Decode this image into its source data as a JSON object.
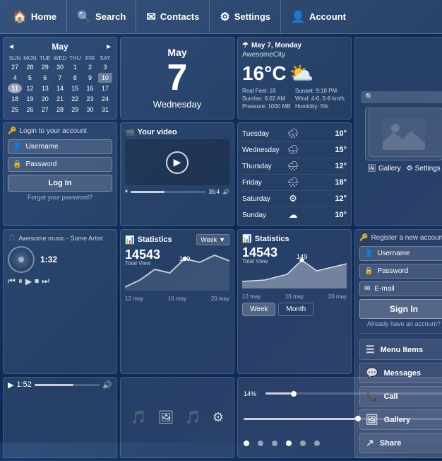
{
  "nav": {
    "items": [
      {
        "label": "Home",
        "icon": "🏠"
      },
      {
        "label": "Search",
        "icon": "🔍"
      },
      {
        "label": "Contacts",
        "icon": "✉"
      },
      {
        "label": "Settings",
        "icon": "⚙"
      },
      {
        "label": "Account",
        "icon": "👤"
      }
    ]
  },
  "calendar": {
    "month": "May",
    "prev_arrow": "◄",
    "next_arrow": "►",
    "day_names": [
      "SUN",
      "MON",
      "TUE",
      "WED",
      "THU",
      "FRI",
      "SAT"
    ],
    "days": [
      "27",
      "28",
      "29",
      "30",
      "1",
      "2",
      "3",
      "4",
      "5",
      "6",
      "7",
      "8",
      "9",
      "10",
      "11",
      "12",
      "13",
      "14",
      "15",
      "16",
      "17",
      "18",
      "19",
      "20",
      "21",
      "22",
      "23",
      "24",
      "25",
      "26",
      "27",
      "28",
      "29",
      "30",
      "31"
    ],
    "today_idx": 13,
    "highlight_idx": 14
  },
  "bigdate": {
    "month": "May",
    "day": "7",
    "weekday": "Wednesday"
  },
  "weather": {
    "title": "May 7, Monday",
    "city": "AwesomeCity",
    "temp": "16°C",
    "feel": "Real Feel: 18",
    "sunrise": "Sunrise: 6:02 AM",
    "wind": "Wind: 4-6, 5-9 km/h",
    "pressure": "Pressure: 1000 MB",
    "humidity": "Humidity: 5%",
    "sunset": "Sunset: 9:18 PM"
  },
  "photo": {
    "search_placeholder": "🔍",
    "gallery_label": "Gallery",
    "settings_label": "Settings"
  },
  "login": {
    "title": "Login to your account",
    "username_placeholder": "Username",
    "password_placeholder": "Password",
    "login_btn": "Log In",
    "forgot": "Forgot your password?"
  },
  "video": {
    "title": "Your video",
    "time": "35:4"
  },
  "forecast": {
    "days": [
      {
        "day": "Tuesday",
        "icon": "🌧",
        "temp": "10°"
      },
      {
        "day": "Wednesday",
        "icon": "🌧",
        "temp": "15°"
      },
      {
        "day": "Thursday",
        "icon": "🌧",
        "temp": "12°"
      },
      {
        "day": "Friday",
        "icon": "🌧",
        "temp": "18°"
      },
      {
        "day": "Saturday",
        "icon": "⚙",
        "temp": "12°"
      },
      {
        "day": "Sunday",
        "icon": "☁",
        "temp": "10°"
      }
    ]
  },
  "register": {
    "title": "Register a new account",
    "username_placeholder": "Username",
    "password_placeholder": "Password",
    "email_placeholder": "E-mail",
    "signin_btn": "Sign In",
    "already": "Already have an account?"
  },
  "music": {
    "song": "Awesome music - Some Artist",
    "time": "1:32",
    "progress_label": "1:52"
  },
  "stats1": {
    "title": "Statistics",
    "week_btn": "Week",
    "total_views": "14543",
    "total_label": "Total View",
    "num": "149",
    "labels": [
      "12 may",
      "16 may",
      "20 may"
    ]
  },
  "stats2": {
    "title": "Statistics",
    "total_views": "14543",
    "total_label": "Total View",
    "num": "149",
    "labels": [
      "12 may",
      "16 may",
      "20 may"
    ],
    "week_btn": "Week",
    "month_btn": "Month"
  },
  "player_bar": {
    "time": "1:52",
    "progress_pct": 60
  },
  "icons_panel": {
    "icons": [
      "🎵",
      "🖼",
      "🎵",
      "⚙"
    ]
  },
  "slider": {
    "pct_label": "14%",
    "pct_val": 14,
    "dots": [
      0,
      1,
      2,
      3,
      4,
      5
    ]
  },
  "menu": {
    "items": [
      {
        "label": "Menu Items",
        "icon": "☰"
      },
      {
        "label": "Messages",
        "icon": "💬"
      },
      {
        "label": "Call",
        "icon": "📞"
      },
      {
        "label": "Gallery",
        "icon": "🖼"
      },
      {
        "label": "Share",
        "icon": "↗"
      }
    ]
  }
}
